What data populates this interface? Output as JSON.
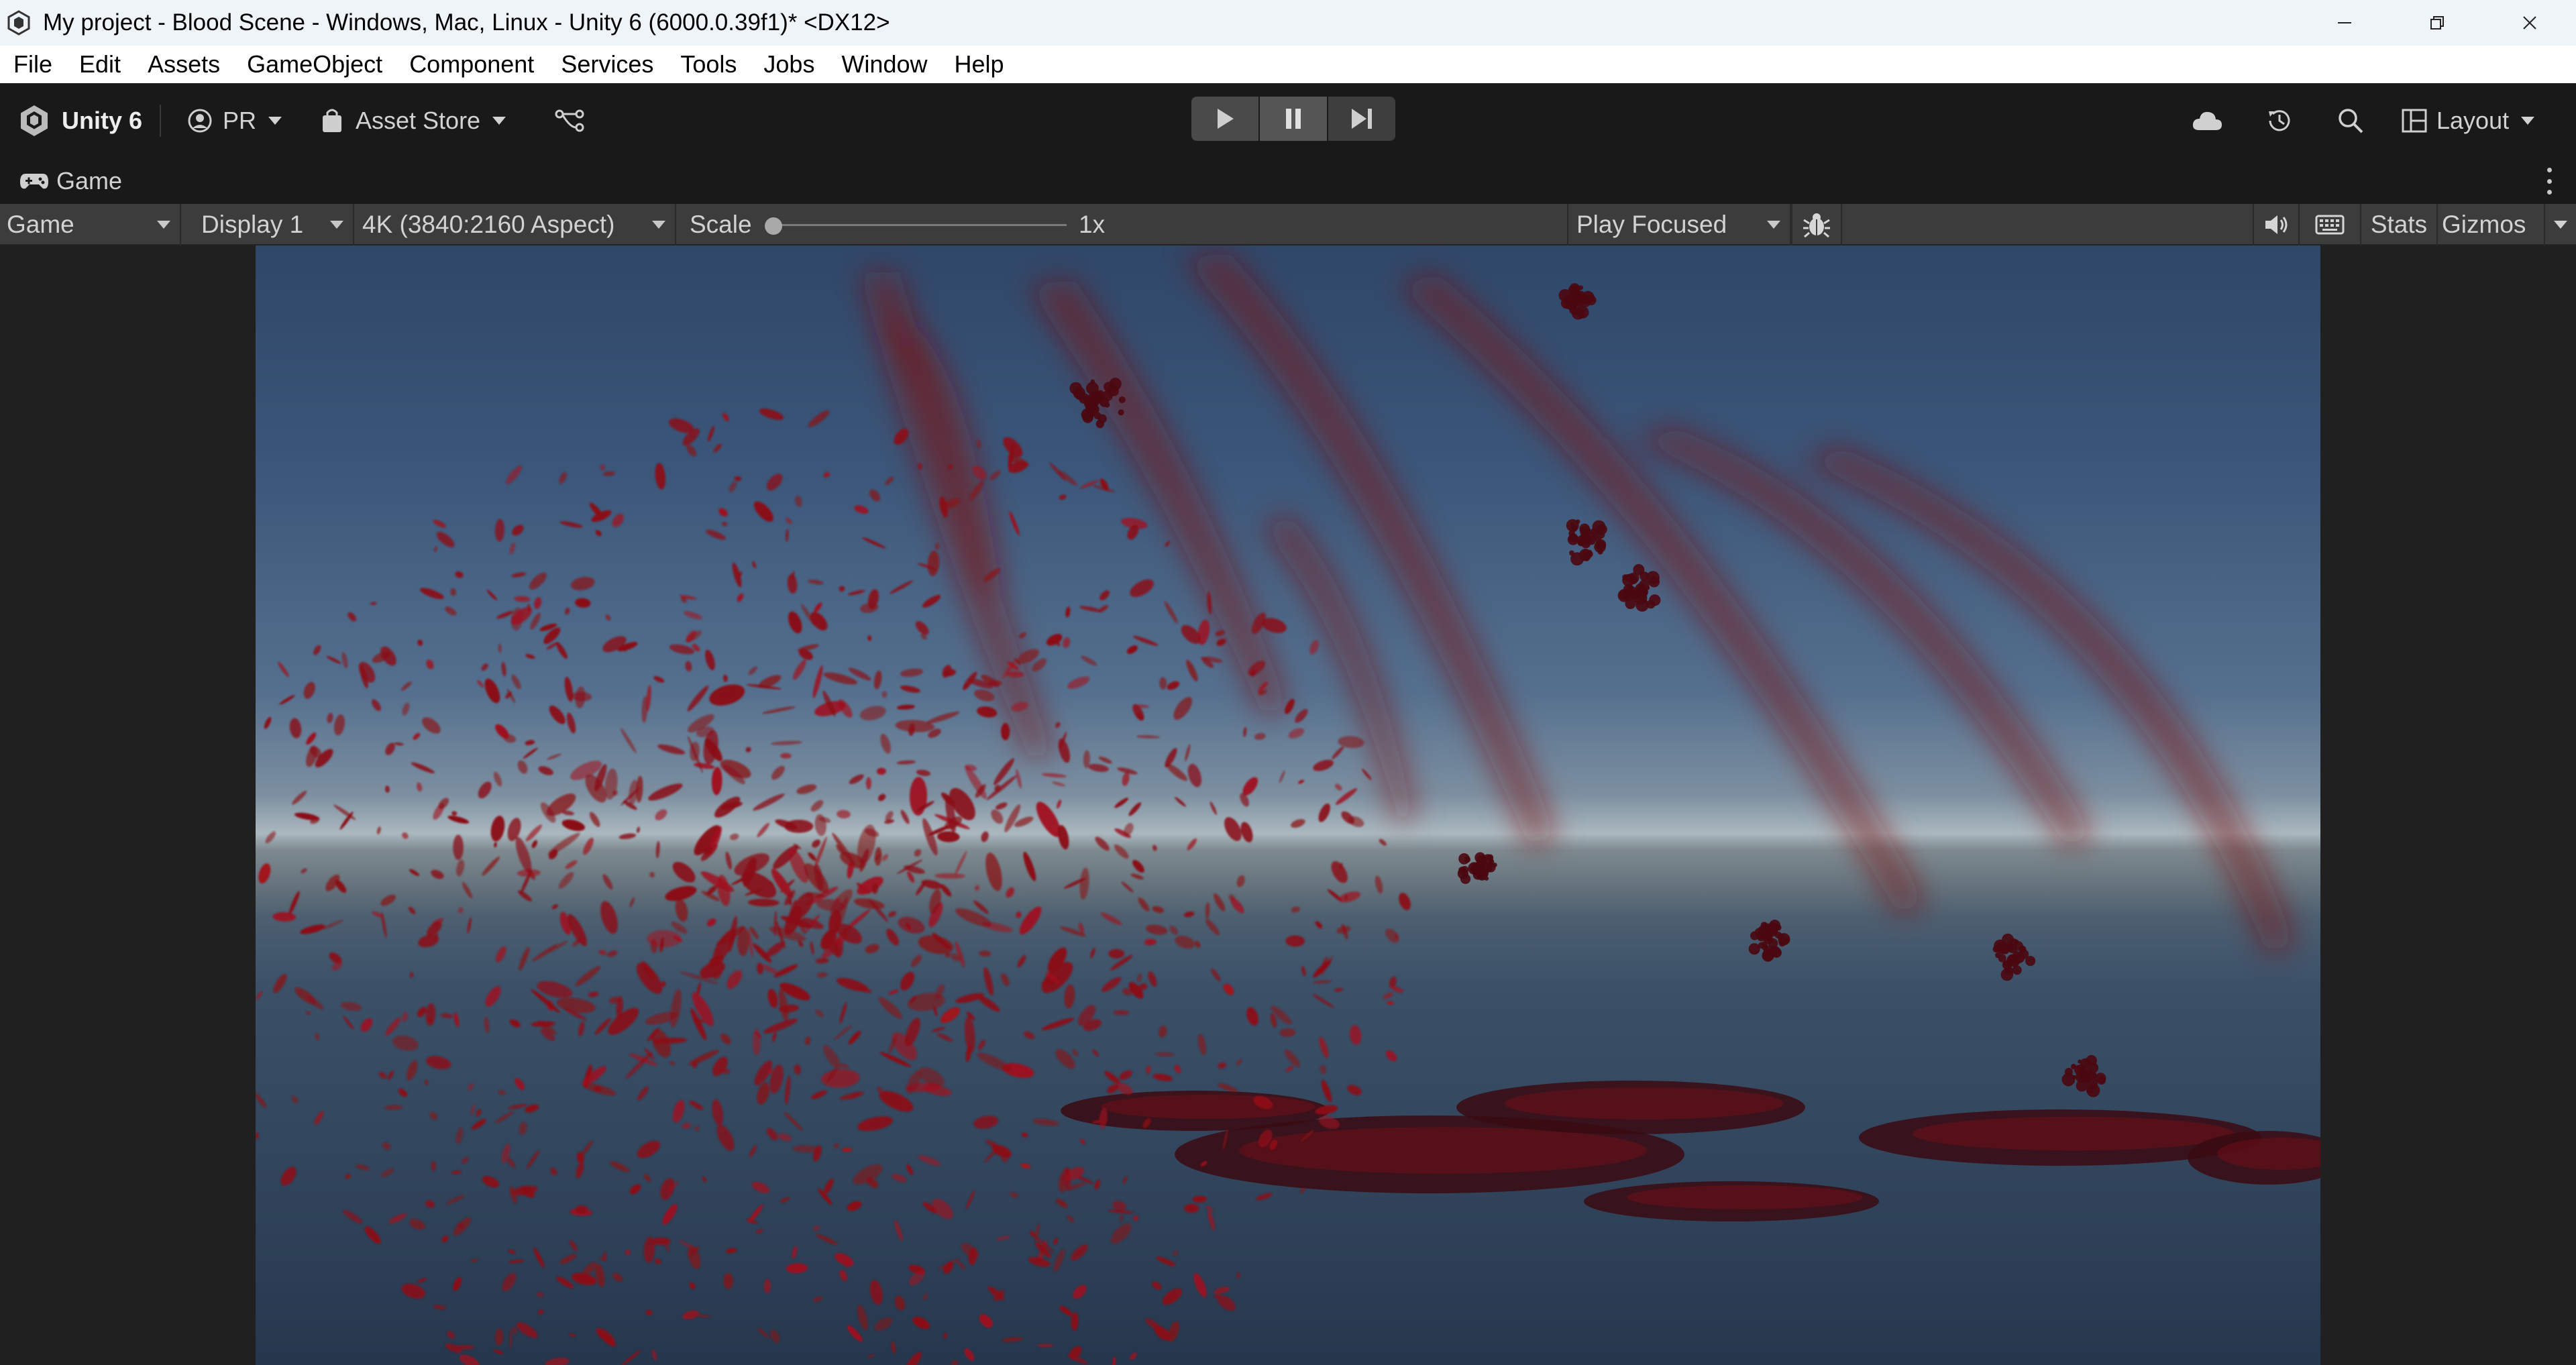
{
  "window": {
    "title": "My project - Blood Scene - Windows, Mac, Linux - Unity 6 (6000.0.39f1)* <DX12>",
    "controls": [
      "minimize-icon",
      "restore-icon",
      "close-icon"
    ]
  },
  "menubar": {
    "items": [
      "File",
      "Edit",
      "Assets",
      "GameObject",
      "Component",
      "Services",
      "Tools",
      "Jobs",
      "Window",
      "Help"
    ]
  },
  "toolbar": {
    "unity_label": "Unity 6",
    "account_label": "PR",
    "asset_store_label": "Asset Store",
    "layout_label": "Layout",
    "play_controls": [
      "play-icon",
      "pause-icon",
      "step-icon"
    ],
    "right_icons": [
      "cloud-icon",
      "history-icon",
      "search-icon",
      "layout-icon"
    ]
  },
  "tab": {
    "label": "Game"
  },
  "game_toolbar": {
    "view_mode": "Game",
    "display": "Display 1",
    "resolution": "4K (3840:2160 Aspect)",
    "scale_label": "Scale",
    "scale_value": "1x",
    "play_mode": "Play Focused",
    "stats_label": "Stats",
    "gizmos_label": "Gizmos"
  },
  "colors": {
    "editor_bg": "#191919",
    "toolbar_bg": "#3c3c3c",
    "blood": "#8a0f16",
    "sky_top": "#2f4769",
    "horizon": "#aab8bf"
  }
}
